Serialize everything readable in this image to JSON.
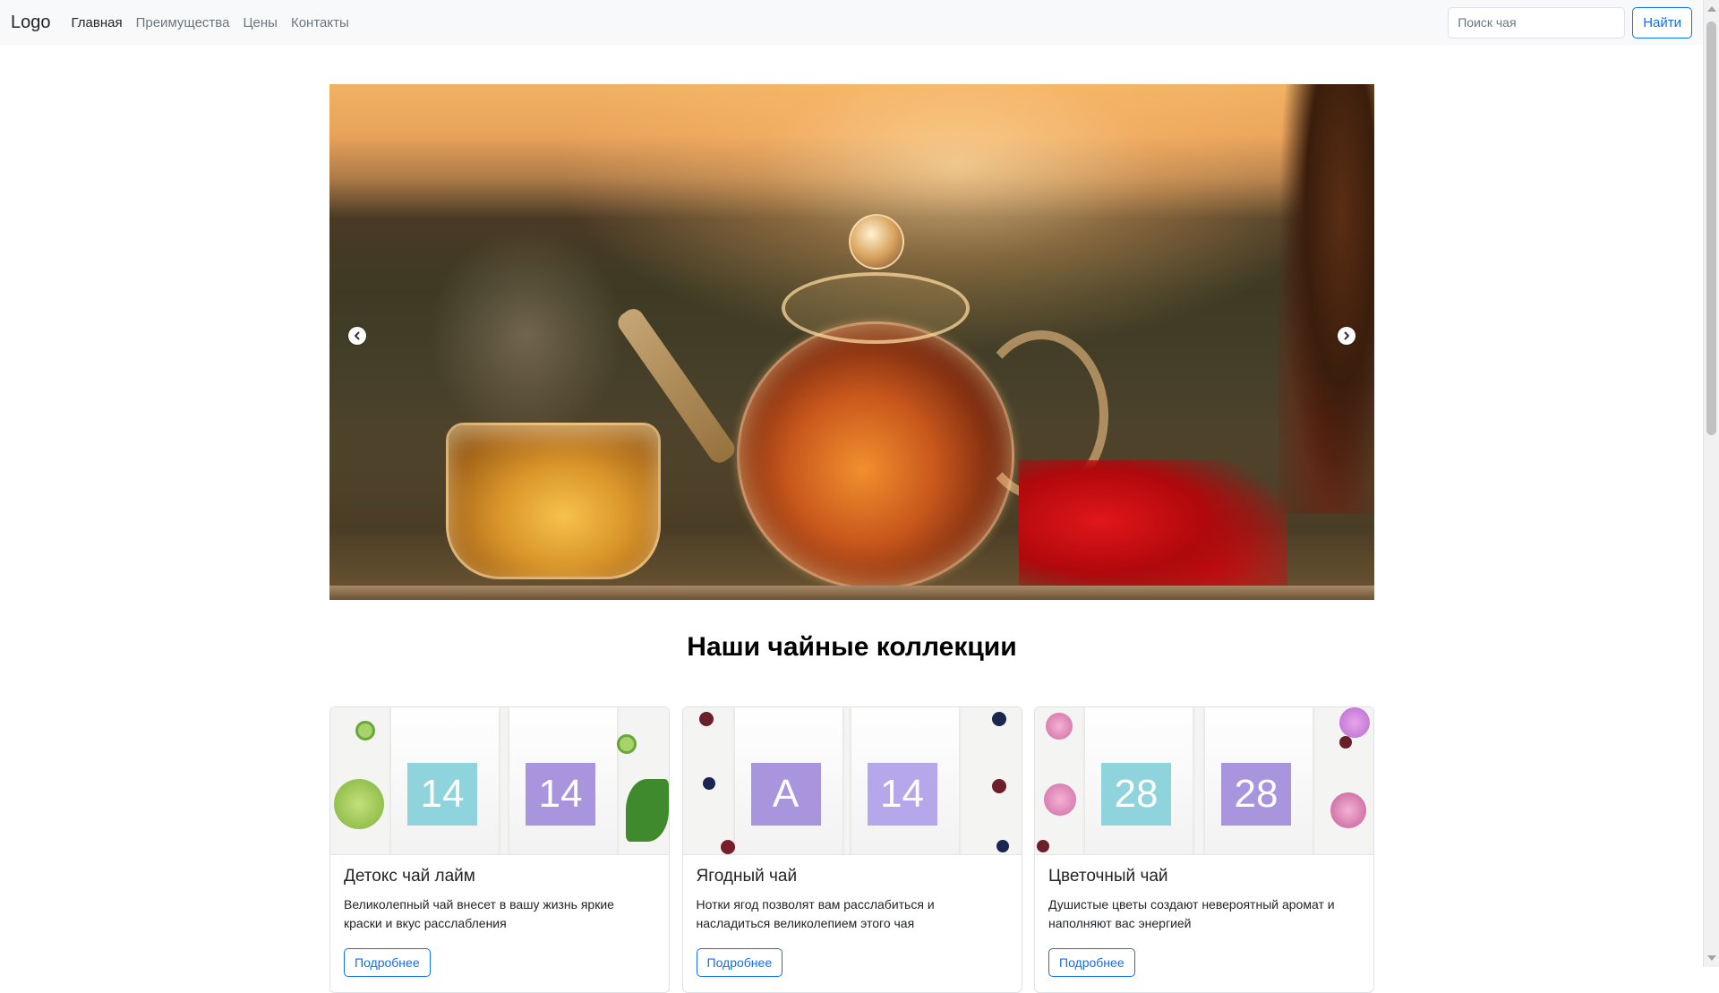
{
  "navbar": {
    "brand": "Logo",
    "links": [
      {
        "label": "Главная",
        "active": true
      },
      {
        "label": "Преимущества",
        "active": false
      },
      {
        "label": "Цены",
        "active": false
      },
      {
        "label": "Контакты",
        "active": false
      }
    ],
    "search": {
      "placeholder": "Поиск чая",
      "value": ""
    },
    "search_button": "Найти"
  },
  "carousel": {
    "prev_icon": "chevron-left-icon",
    "next_icon": "chevron-right-icon",
    "image": "teapot-sunset-photo"
  },
  "section": {
    "title": "Наши чайные коллекции"
  },
  "cards": [
    {
      "title": "Детокс чай лайм",
      "text": "Великолепный чай внесет в вашу жизнь яркие краски и вкус расслабления",
      "button": "Подробнее",
      "packs": [
        "14",
        "14"
      ],
      "pack_colors": [
        "#8fd3dc",
        "#a995de"
      ],
      "image": "lime-tea-packs-photo"
    },
    {
      "title": "Ягодный чай",
      "text": "Нотки ягод позволят вам расслабиться и насладиться великолепием этого чая",
      "button": "Подробнее",
      "packs": [
        "A",
        "14"
      ],
      "pack_colors": [
        "#a995de",
        "#b6a7ea"
      ],
      "image": "berry-tea-packs-photo"
    },
    {
      "title": "Цветочный чай",
      "text": "Душистые цветы создают невероятный аромат и наполняют вас энергией",
      "button": "Подробнее",
      "packs": [
        "28",
        "28"
      ],
      "pack_colors": [
        "#8fd3dc",
        "#a995de"
      ],
      "image": "flower-tea-packs-photo"
    }
  ],
  "colors": {
    "accent": "#0d6efd",
    "navbar_bg": "#f8f9fa"
  }
}
